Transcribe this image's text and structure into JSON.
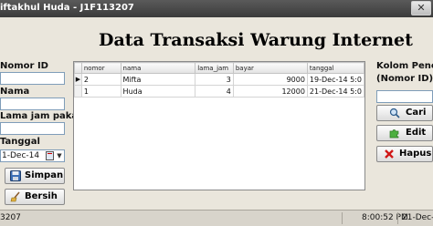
{
  "window": {
    "title": "iftakhul Huda - J1F113207",
    "close_glyph": "✕"
  },
  "heading": "Data Transaksi Warung Internet",
  "form": {
    "nomor_id_label": "Nomor ID",
    "nama_label": "Nama",
    "lama_jam_label": "Lama jam pakai",
    "tanggal_label": "Tanggal",
    "tanggal_value": "1-Dec-14",
    "simpan_label": "Simpan",
    "bersih_label": "Bersih"
  },
  "table": {
    "columns": [
      "nomor",
      "nama",
      "lama_jam",
      "bayar",
      "tanggal"
    ],
    "rows": [
      {
        "nomor": "2",
        "nama": "Mifta",
        "lama_jam": "3",
        "bayar": "9000",
        "tanggal": "19-Dec-14 5:0"
      },
      {
        "nomor": "1",
        "nama": "Huda",
        "lama_jam": "4",
        "bayar": "12000",
        "tanggal": "21-Dec-14 5:0"
      }
    ],
    "current_row_marker": "▶"
  },
  "search": {
    "label_line1": "Kolom Pencari",
    "label_line2": "(Nomor ID)",
    "cari_label": "Cari",
    "edit_label": "Edit",
    "hapus_label": "Hapus"
  },
  "status": {
    "left": "3207",
    "time": "8:00:52 PM",
    "date": "21-Dec-14"
  },
  "colors": {
    "title_bar": "#4a4a4a",
    "background": "#eae6dc",
    "input_border": "#7f9db9"
  },
  "icons": {
    "simpan": "floppy-disk-icon",
    "bersih": "broom-icon",
    "cari": "magnifier-icon",
    "edit": "puzzle-piece-icon",
    "hapus": "red-x-icon",
    "calendar": "calendar-icon"
  }
}
